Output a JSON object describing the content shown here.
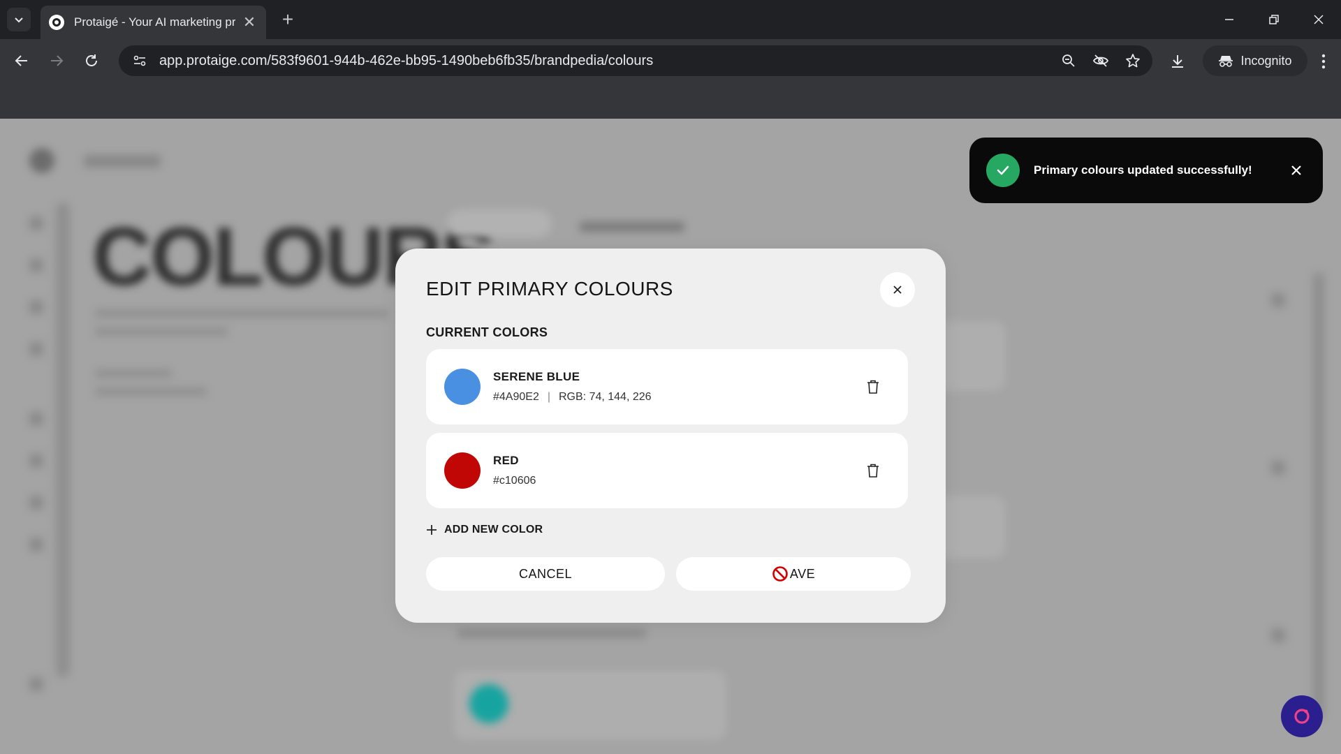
{
  "browser": {
    "tab_title": "Protaigé - Your AI marketing pr",
    "url": "app.protaige.com/583f9601-944b-462e-bb95-1490beb6fb35/brandpedia/colours",
    "incognito_label": "Incognito"
  },
  "background": {
    "heading": "COLOURS"
  },
  "toast": {
    "message": "Primary colours updated successfully!",
    "success_color": "#27a862"
  },
  "modal": {
    "title": "EDIT PRIMARY COLOURS",
    "section_label": "CURRENT COLORS",
    "colors": [
      {
        "name": "SERENE BLUE",
        "hex": "#4A90E2",
        "rgb": "RGB: 74, 144, 226",
        "swatch": "#4A90E2"
      },
      {
        "name": "RED",
        "hex": "#c10606",
        "swatch": "#c10606"
      }
    ],
    "add_label": "ADD NEW COLOR",
    "cancel_label": "CANCEL",
    "save_label": "AVE"
  },
  "icons": {
    "tab_search": "chevron-down-icon",
    "favicon": "protaige-logo-icon",
    "close": "close-icon",
    "trash": "trash-icon",
    "add": "plus-icon",
    "check": "check-icon",
    "help": "help-chat-icon",
    "cursor": "not-allowed-cursor-icon"
  }
}
